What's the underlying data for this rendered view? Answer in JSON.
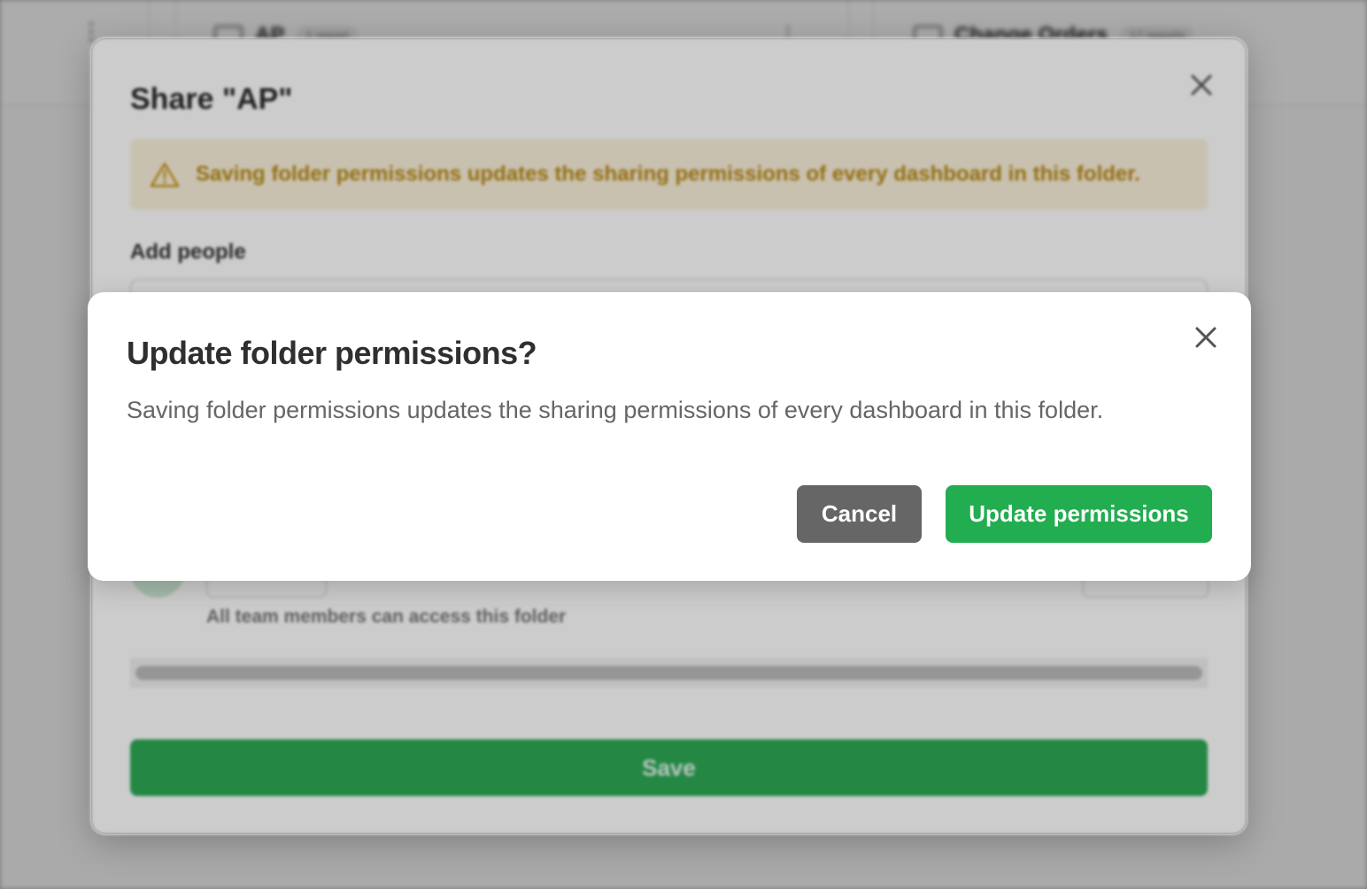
{
  "background": {
    "folders": [
      {
        "name": "AP",
        "badge": "1 report"
      },
      {
        "name": "Change Orders",
        "badge": "17 reports"
      }
    ],
    "more_menu_glyph": "⋮"
  },
  "share_dialog": {
    "title": "Share \"AP\"",
    "warning_text": "Saving folder permissions updates the sharing permissions of every dashboard in this folder.",
    "add_people_label": "Add people",
    "access_note": "All team members can access this folder",
    "save_label": "Save"
  },
  "confirm_dialog": {
    "title": "Update folder permissions?",
    "body": "Saving folder permissions updates the sharing permissions of every dashboard in this folder.",
    "cancel_label": "Cancel",
    "confirm_label": "Update permissions"
  },
  "icons": {
    "close": "close-icon",
    "warning": "warning-triangle-icon",
    "folder": "folder-icon",
    "kebab": "kebab-menu-icon"
  },
  "colors": {
    "primary": "#22ad50",
    "cancel": "#666666",
    "warning_bg": "#fbf2dc",
    "warning_text": "#b98a16"
  }
}
